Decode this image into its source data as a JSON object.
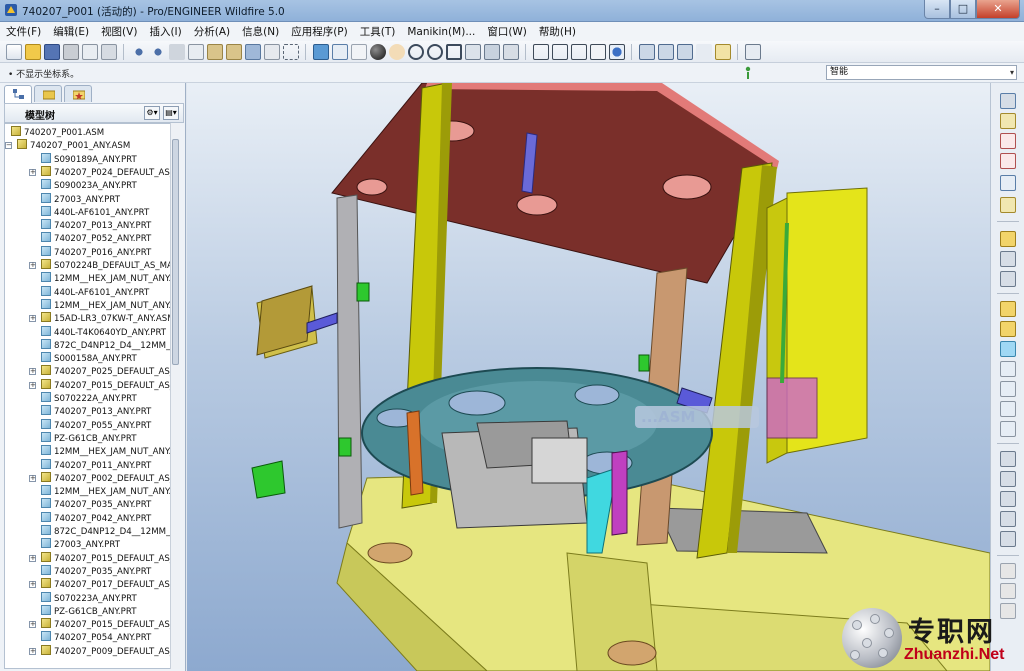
{
  "window": {
    "title": "740207_P001 (活动的) - Pro/ENGINEER Wildfire 5.0",
    "min": "–",
    "max": "□",
    "close": "✕"
  },
  "menu": [
    "文件(F)",
    "编辑(E)",
    "视图(V)",
    "插入(I)",
    "分析(A)",
    "信息(N)",
    "应用程序(P)",
    "工具(T)",
    "Manikin(M)...",
    "窗口(W)",
    "帮助(H)"
  ],
  "status": {
    "message": "• 不显示坐标系。",
    "filter_value": "智能",
    "filter_arrow": "▾"
  },
  "tree": {
    "header": "模型树",
    "tools": [
      "⚙▾",
      "▤▾"
    ],
    "rows": [
      {
        "label": "740207_P001.ASM",
        "type": "asm",
        "level": 0,
        "expander": ""
      },
      {
        "label": "740207_P001_ANY.ASM",
        "type": "asm",
        "level": 1,
        "expander": "−"
      },
      {
        "label": "S090189A_ANY.PRT",
        "type": "prt",
        "level": 2,
        "expander": ""
      },
      {
        "label": "740207_P024_DEFAULT_AS_MA",
        "type": "asm",
        "level": 2,
        "expander": "+"
      },
      {
        "label": "S090023A_ANY.PRT",
        "type": "prt",
        "level": 2,
        "expander": ""
      },
      {
        "label": "27003_ANY.PRT",
        "type": "prt",
        "level": 2,
        "expander": ""
      },
      {
        "label": "440L-AF6101_ANY.PRT",
        "type": "prt",
        "level": 2,
        "expander": ""
      },
      {
        "label": "740207_P013_ANY.PRT",
        "type": "prt",
        "level": 2,
        "expander": ""
      },
      {
        "label": "740207_P052_ANY.PRT",
        "type": "prt",
        "level": 2,
        "expander": ""
      },
      {
        "label": "740207_P016_ANY.PRT",
        "type": "prt",
        "level": 2,
        "expander": ""
      },
      {
        "label": "S070224B_DEFAULT_AS_MACH",
        "type": "asm",
        "level": 2,
        "expander": "+"
      },
      {
        "label": "12MM__HEX_JAM_NUT_ANY.P",
        "type": "prt",
        "level": 2,
        "expander": ""
      },
      {
        "label": "440L-AF6101_ANY.PRT",
        "type": "prt",
        "level": 2,
        "expander": ""
      },
      {
        "label": "12MM__HEX_JAM_NUT_ANY.P",
        "type": "prt",
        "level": 2,
        "expander": ""
      },
      {
        "label": "15AD-LR3_07KW-T_ANY.ASM",
        "type": "asm",
        "level": 2,
        "expander": "+"
      },
      {
        "label": "440L-T4K0640YD_ANY.PRT",
        "type": "prt",
        "level": 2,
        "expander": ""
      },
      {
        "label": "872C_D4NP12_D4__12MM_PR",
        "type": "prt",
        "level": 2,
        "expander": ""
      },
      {
        "label": "S000158A_ANY.PRT",
        "type": "prt",
        "level": 2,
        "expander": ""
      },
      {
        "label": "740207_P025_DEFAULT_AS_MA",
        "type": "asm",
        "level": 2,
        "expander": "+"
      },
      {
        "label": "740207_P015_DEFAULT_AS_MA",
        "type": "asm",
        "level": 2,
        "expander": "+"
      },
      {
        "label": "S070222A_ANY.PRT",
        "type": "prt",
        "level": 2,
        "expander": ""
      },
      {
        "label": "740207_P013_ANY.PRT",
        "type": "prt",
        "level": 2,
        "expander": ""
      },
      {
        "label": "740207_P055_ANY.PRT",
        "type": "prt",
        "level": 2,
        "expander": ""
      },
      {
        "label": "PZ-G61CB_ANY.PRT",
        "type": "prt",
        "level": 2,
        "expander": ""
      },
      {
        "label": "12MM__HEX_JAM_NUT_ANY.P",
        "type": "prt",
        "level": 2,
        "expander": ""
      },
      {
        "label": "740207_P011_ANY.PRT",
        "type": "prt",
        "level": 2,
        "expander": ""
      },
      {
        "label": "740207_P002_DEFAULT_AS_MA",
        "type": "asm",
        "level": 2,
        "expander": "+"
      },
      {
        "label": "12MM__HEX_JAM_NUT_ANY.P",
        "type": "prt",
        "level": 2,
        "expander": ""
      },
      {
        "label": "740207_P035_ANY.PRT",
        "type": "prt",
        "level": 2,
        "expander": ""
      },
      {
        "label": "740207_P042_ANY.PRT",
        "type": "prt",
        "level": 2,
        "expander": ""
      },
      {
        "label": "872C_D4NP12_D4__12MM_PR",
        "type": "prt",
        "level": 2,
        "expander": ""
      },
      {
        "label": "27003_ANY.PRT",
        "type": "prt",
        "level": 2,
        "expander": ""
      },
      {
        "label": "740207_P015_DEFAULT_AS_MA",
        "type": "asm",
        "level": 2,
        "expander": "+"
      },
      {
        "label": "740207_P035_ANY.PRT",
        "type": "prt",
        "level": 2,
        "expander": ""
      },
      {
        "label": "740207_P017_DEFAULT_AS_MA",
        "type": "asm",
        "level": 2,
        "expander": "+"
      },
      {
        "label": "S070223A_ANY.PRT",
        "type": "prt",
        "level": 2,
        "expander": ""
      },
      {
        "label": "PZ-G61CB_ANY.PRT",
        "type": "prt",
        "level": 2,
        "expander": ""
      },
      {
        "label": "740207_P015_DEFAULT_AS_MA",
        "type": "asm",
        "level": 2,
        "expander": "+"
      },
      {
        "label": "740207_P054_ANY.PRT",
        "type": "prt",
        "level": 2,
        "expander": ""
      },
      {
        "label": "740207_P009_DEFAULT_AS_MA",
        "type": "asm",
        "level": 2,
        "expander": "+"
      }
    ]
  },
  "viewport": {
    "obscured_text": "...ASM"
  },
  "watermark": {
    "cn": "专职网",
    "en": "Zhuanzhi.Net"
  },
  "colors": {
    "frame_yellow": "#d6d60e",
    "plate_red": "#7a2f2a",
    "ring_teal": "#4a8a94",
    "base_yellow": "#e4e48a",
    "background_blue": "#9db6d8"
  }
}
